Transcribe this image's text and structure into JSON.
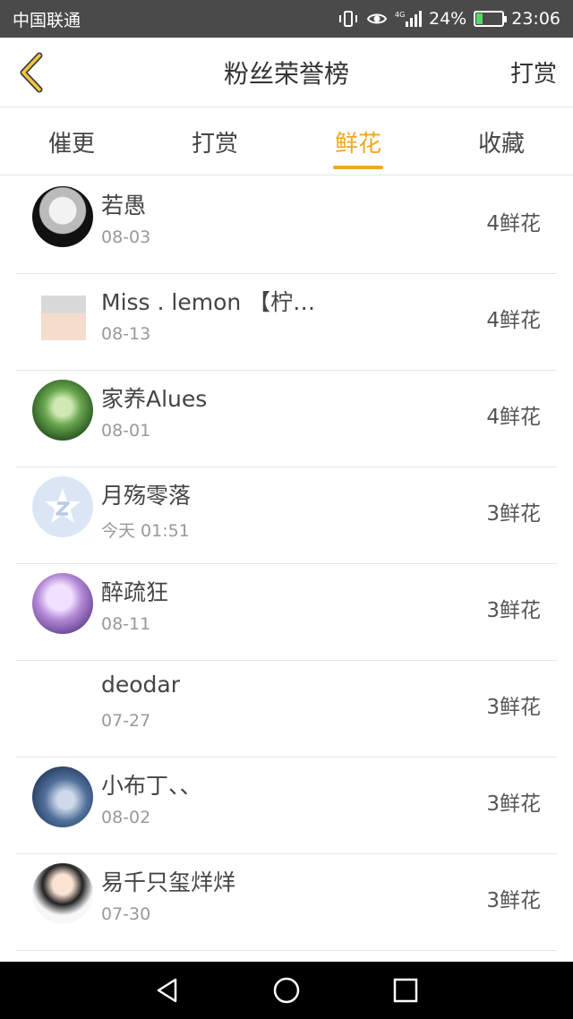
{
  "status_bar": {
    "carrier": "中国联通",
    "network": "4G",
    "battery": "24%",
    "battery_level": 0.24,
    "time": "23:06"
  },
  "header": {
    "title": "粉丝荣誉榜",
    "action_label": "打赏",
    "back_icon": "chevron-left-icon"
  },
  "tabs": [
    {
      "label": "催更",
      "active": false
    },
    {
      "label": "打赏",
      "active": false
    },
    {
      "label": "鲜花",
      "active": true
    },
    {
      "label": "收藏",
      "active": false
    }
  ],
  "colors": {
    "accent": "#f5a623",
    "status_bar_bg": "#4a4a4a",
    "nav_bar_bg": "#000000"
  },
  "fans": [
    {
      "name": "若愚",
      "date": "08-03",
      "amount": "4鲜花"
    },
    {
      "name": "Miss . lemon 【柠…",
      "date": "08-13",
      "amount": "4鲜花"
    },
    {
      "name": "家养Alues",
      "date": "08-01",
      "amount": "4鲜花"
    },
    {
      "name": "月殇零落",
      "date": "今天 01:51",
      "amount": "3鲜花"
    },
    {
      "name": "醉疏狂",
      "date": "08-11",
      "amount": "3鲜花"
    },
    {
      "name": "deodar",
      "date": "07-27",
      "amount": "3鲜花"
    },
    {
      "name": "小布丁、、",
      "date": "08-02",
      "amount": "3鲜花"
    },
    {
      "name": "易千只玺烊烊",
      "date": "07-30",
      "amount": "3鲜花"
    }
  ],
  "nav_bar": [
    "back-triangle-icon",
    "home-circle-icon",
    "recents-square-icon"
  ]
}
